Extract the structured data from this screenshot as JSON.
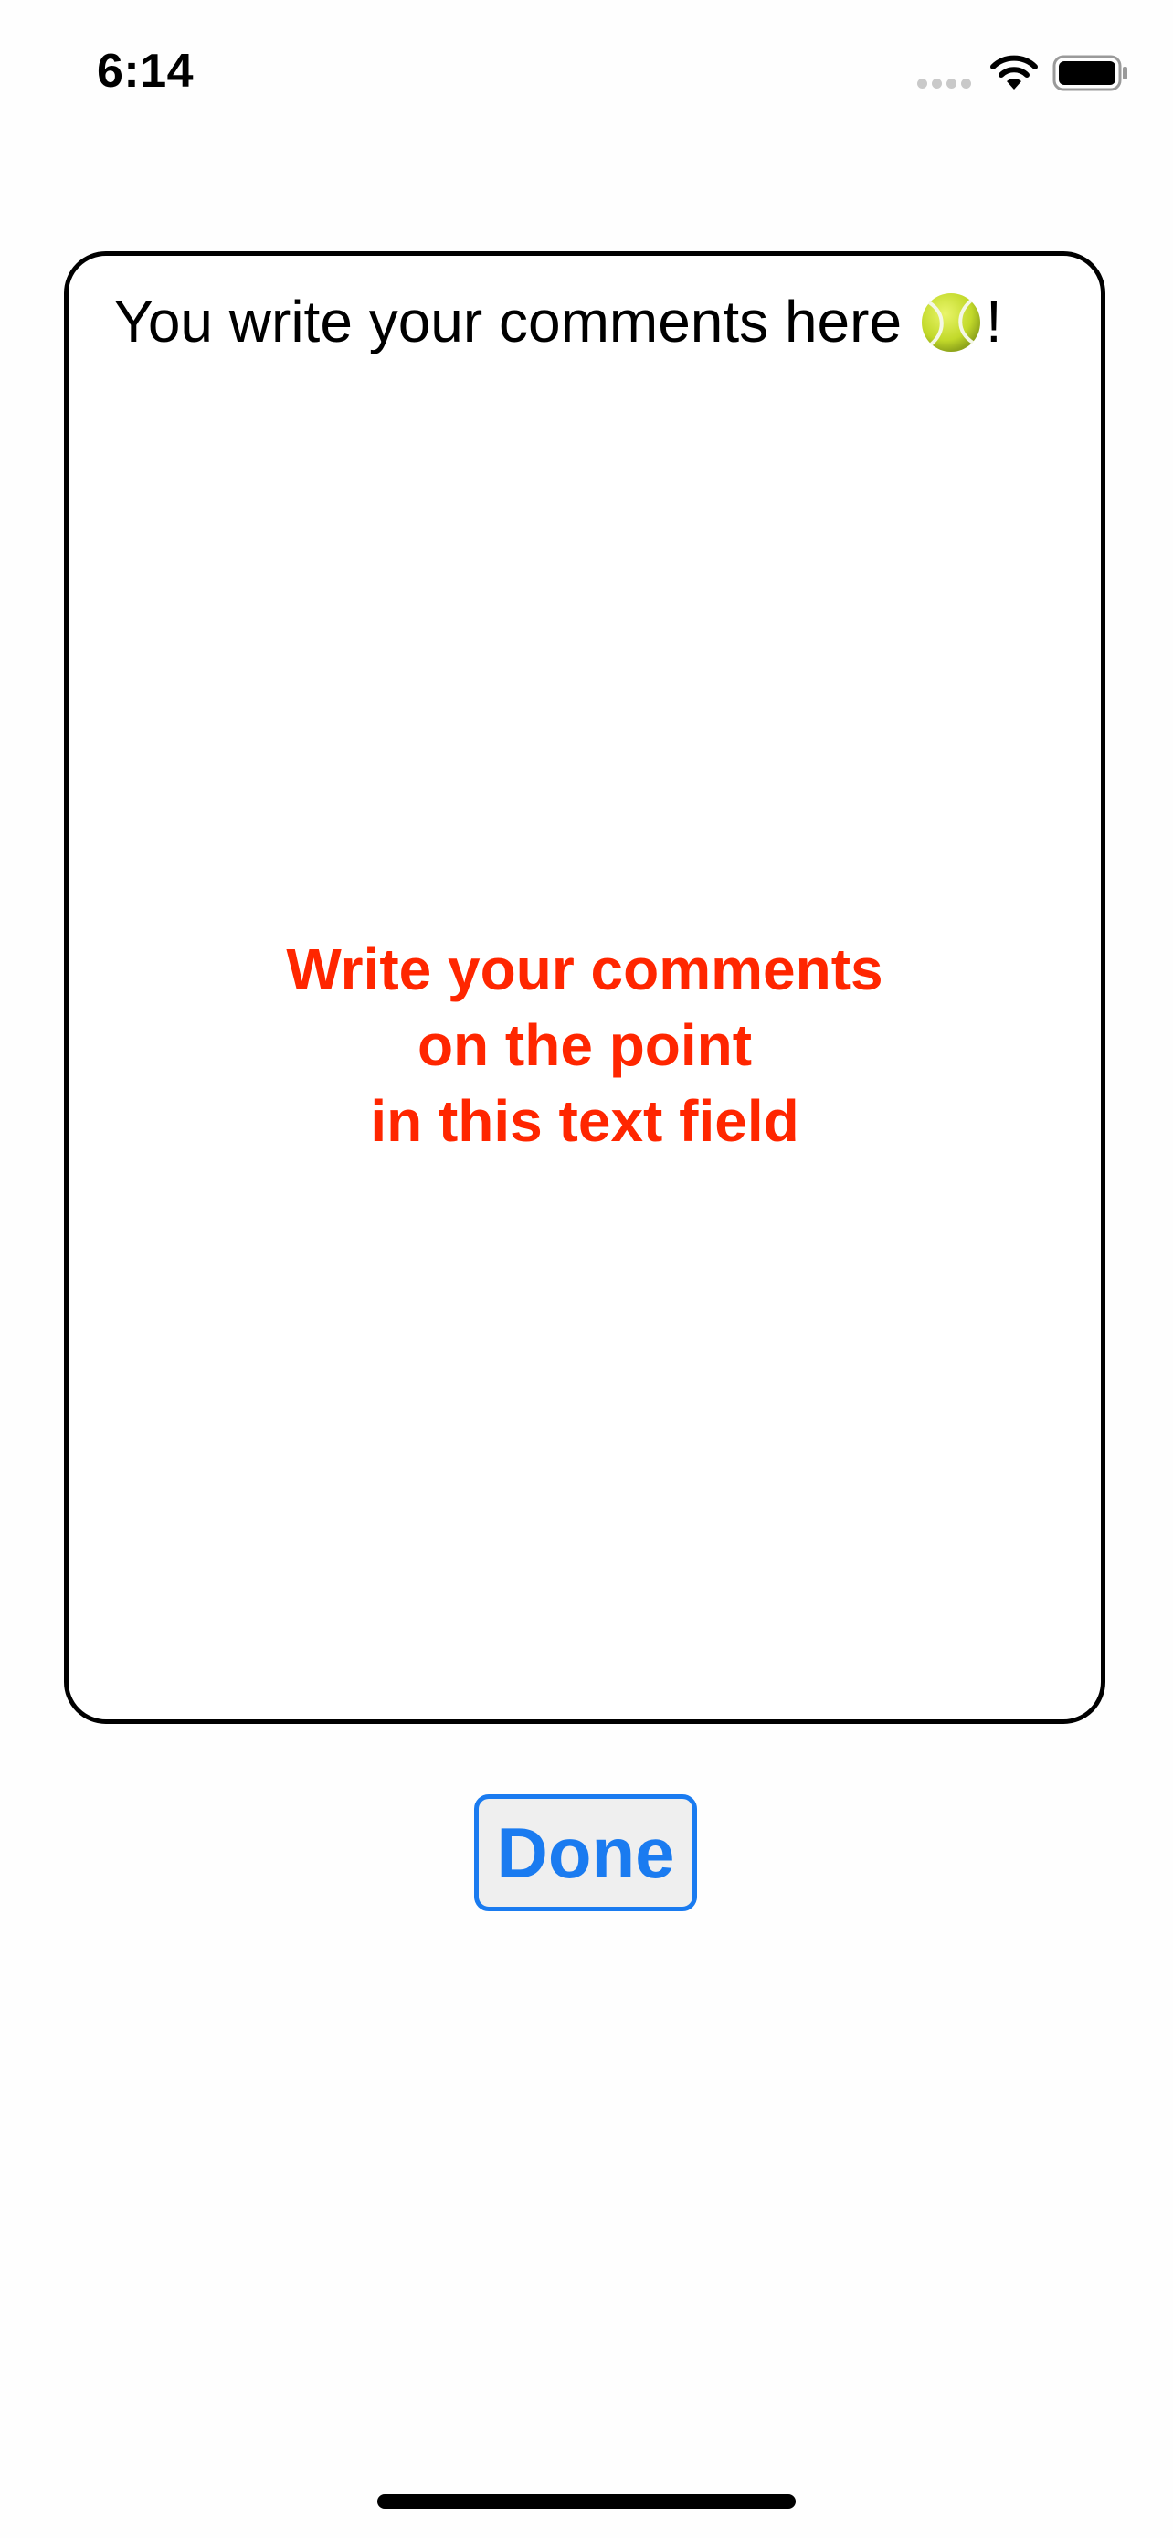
{
  "status_bar": {
    "time": "6:14",
    "signal_icon": "cellular-signal-icon",
    "wifi_icon": "wifi-icon",
    "battery_icon": "battery-icon",
    "battery_level": 1.0
  },
  "comment_field": {
    "value_text": "You write your comments here",
    "value_emoji_icon": "tennis-ball-icon",
    "value_suffix": "!",
    "hint_lines": [
      "Write your comments",
      "on the point",
      "in this text field"
    ],
    "hint_color": "#ff2600",
    "border_color": "#000000"
  },
  "done_button": {
    "label": "Done",
    "color": "#1a7bf0"
  }
}
